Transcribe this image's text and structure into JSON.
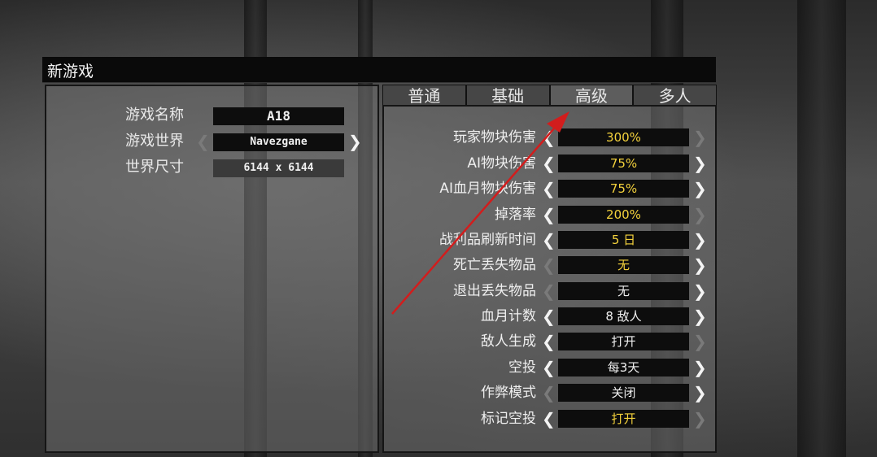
{
  "window": {
    "title": "新游戏"
  },
  "left": {
    "game_name": {
      "label": "游戏名称",
      "value": "A18"
    },
    "game_world": {
      "label": "游戏世界",
      "value": "Navezgane"
    },
    "world_size": {
      "label": "世界尺寸",
      "value": "6144 x 6144"
    }
  },
  "tabs": [
    {
      "label": "普通"
    },
    {
      "label": "基础"
    },
    {
      "label": "高级"
    },
    {
      "label": "多人"
    }
  ],
  "settings": [
    {
      "label": "玩家物块伤害",
      "value": "300%",
      "color": "#f4d23c"
    },
    {
      "label": "AI物块伤害",
      "value": "75%",
      "color": "#f4d23c"
    },
    {
      "label": "AI血月物块伤害",
      "value": "75%",
      "color": "#f4d23c"
    },
    {
      "label": "掉落率",
      "value": "200%",
      "color": "#f4d23c"
    },
    {
      "label": "战利品刷新时间",
      "value": "5 日",
      "color": "#f4d23c"
    },
    {
      "label": "死亡丢失物品",
      "value": "无",
      "color": "#f4d23c"
    },
    {
      "label": "退出丢失物品",
      "value": "无",
      "color": "#f0f0f0"
    },
    {
      "label": "血月计数",
      "value": "8 敌人",
      "color": "#f0f0f0"
    },
    {
      "label": "敌人生成",
      "value": "打开",
      "color": "#f0f0f0"
    },
    {
      "label": "空投",
      "value": "每3天",
      "color": "#f0f0f0"
    },
    {
      "label": "作弊模式",
      "value": "关闭",
      "color": "#f0f0f0"
    },
    {
      "label": "标记空投",
      "value": "打开",
      "color": "#f4d23c"
    }
  ],
  "icons": {
    "left_arrow": "chevron-left-icon",
    "right_arrow": "chevron-right-icon"
  },
  "colors": {
    "accent_value": "#f4d23c",
    "annotation_arrow": "#d21d1d"
  }
}
